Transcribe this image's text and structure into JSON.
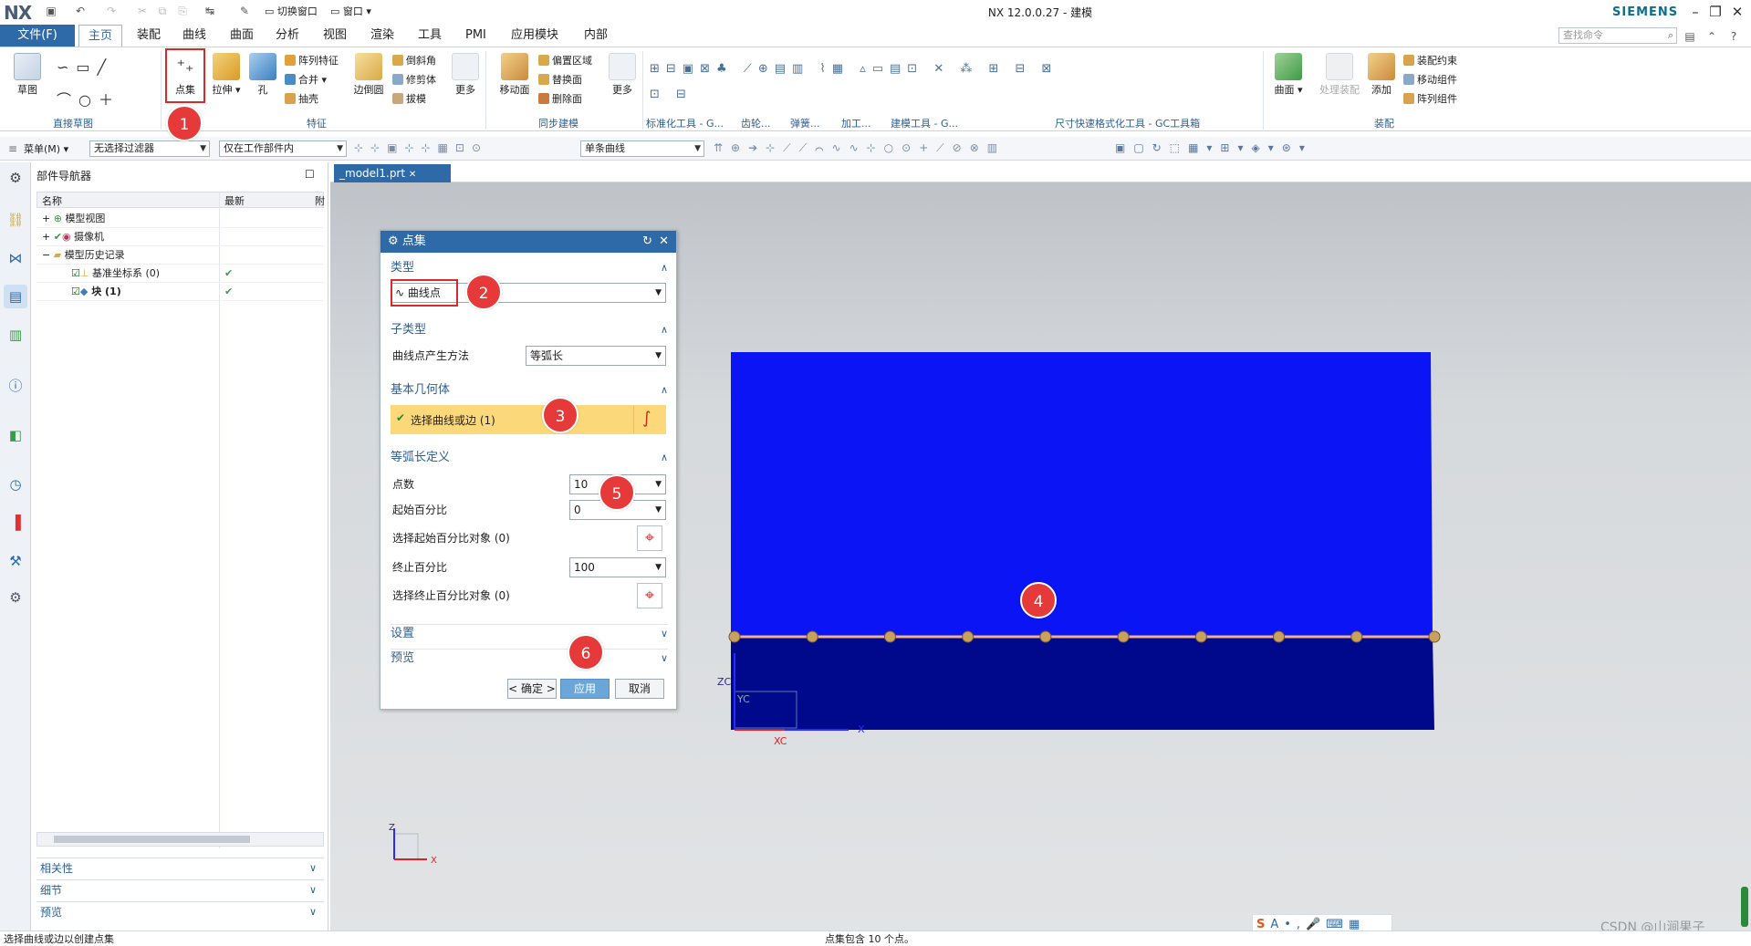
{
  "window": {
    "app_logo": "NX",
    "title": "NX 12.0.0.27 - 建模",
    "brand": "SIEMENS",
    "search_placeholder": "查找命令"
  },
  "menu": {
    "file": "文件(F)",
    "tabs": [
      "主页",
      "装配",
      "曲线",
      "曲面",
      "分析",
      "视图",
      "渲染",
      "工具",
      "PMI",
      "应用模块",
      "内部"
    ],
    "active_tab": "主页"
  },
  "quick_access": {
    "switch_window": "切换窗口",
    "window": "窗口"
  },
  "ribbon": {
    "sketch": "草图",
    "point_set": "点集",
    "extrude": "拉伸",
    "hole": "孔",
    "pattern_feature": "阵列特征",
    "unite": "合并",
    "shell": "抽壳",
    "edge_blend": "边倒圆",
    "chamfer": "倒斜角",
    "trim_body": "修剪体",
    "draft": "拔模",
    "more1": "更多",
    "move_face": "移动面",
    "offset_region": "偏置区域",
    "replace_face": "替换面",
    "delete_face": "删除面",
    "more2": "更多",
    "surface": "曲面",
    "processing_asm": "处理装配",
    "add": "添加",
    "asm_constraint": "装配约束",
    "move_component": "移动组件",
    "pattern_component": "阵列组件",
    "groups": {
      "direct_sketch": "直接草图",
      "feature": "特征",
      "sync_modeling": "同步建模",
      "std_tools": "标准化工具 - G...",
      "gear": "齿轮...",
      "spring": "弹簧...",
      "machining": "加工...",
      "model_tools": "建模工具 - G...",
      "dim_quick": "尺寸快速格式化工具 - GC工具箱",
      "assembly": "装配"
    }
  },
  "toolbar2": {
    "menu": "菜单(M)",
    "filter": "无选择过滤器",
    "scope": "仅在工作部件内",
    "curve_rule": "单条曲线"
  },
  "navigator": {
    "title": "部件导航器",
    "columns": [
      "名称",
      "最新",
      "附"
    ],
    "rows": [
      {
        "label": "模型视图",
        "latest": ""
      },
      {
        "label": "摄像机",
        "latest": ""
      },
      {
        "label": "模型历史记录",
        "latest": ""
      },
      {
        "label": "基准坐标系 (0)",
        "latest": "✔"
      },
      {
        "label": "块 (1)",
        "latest": "✔"
      }
    ],
    "bottom": [
      "相关性",
      "细节",
      "预览"
    ]
  },
  "file_tab": "_model1.prt",
  "dialog": {
    "title": "点集",
    "type_section": "类型",
    "type_value": "曲线点",
    "subtype_section": "子类型",
    "subtype_label": "曲线点产生方法",
    "subtype_value": "等弧长",
    "base_geom_section": "基本几何体",
    "select_curve": "选择曲线或边 (1)",
    "arc_def_section": "等弧长定义",
    "count_label": "点数",
    "count_value": "10",
    "start_label": "起始百分比",
    "start_value": "0",
    "select_start_obj": "选择起始百分比对象 (0)",
    "end_label": "终止百分比",
    "end_value": "100",
    "select_end_obj": "选择终止百分比对象 (0)",
    "settings": "设置",
    "preview": "预览",
    "ok": "< 确定 >",
    "apply": "应用",
    "cancel": "取消"
  },
  "badges": [
    "1",
    "2",
    "3",
    "4",
    "5",
    "6"
  ],
  "axes": {
    "zc": "ZC",
    "yc": "YC",
    "xc": "XC",
    "x": "X",
    "z": "Z"
  },
  "status": {
    "left": "选择曲线或边以创建点集",
    "center": "点集包含 10 个点。"
  },
  "watermark": "CSDN @山涧果子",
  "colors": {
    "accent": "#2d6aa7",
    "block_top": "#0a14f5",
    "block_bottom": "#00088c",
    "badge": "#e63a3a"
  }
}
